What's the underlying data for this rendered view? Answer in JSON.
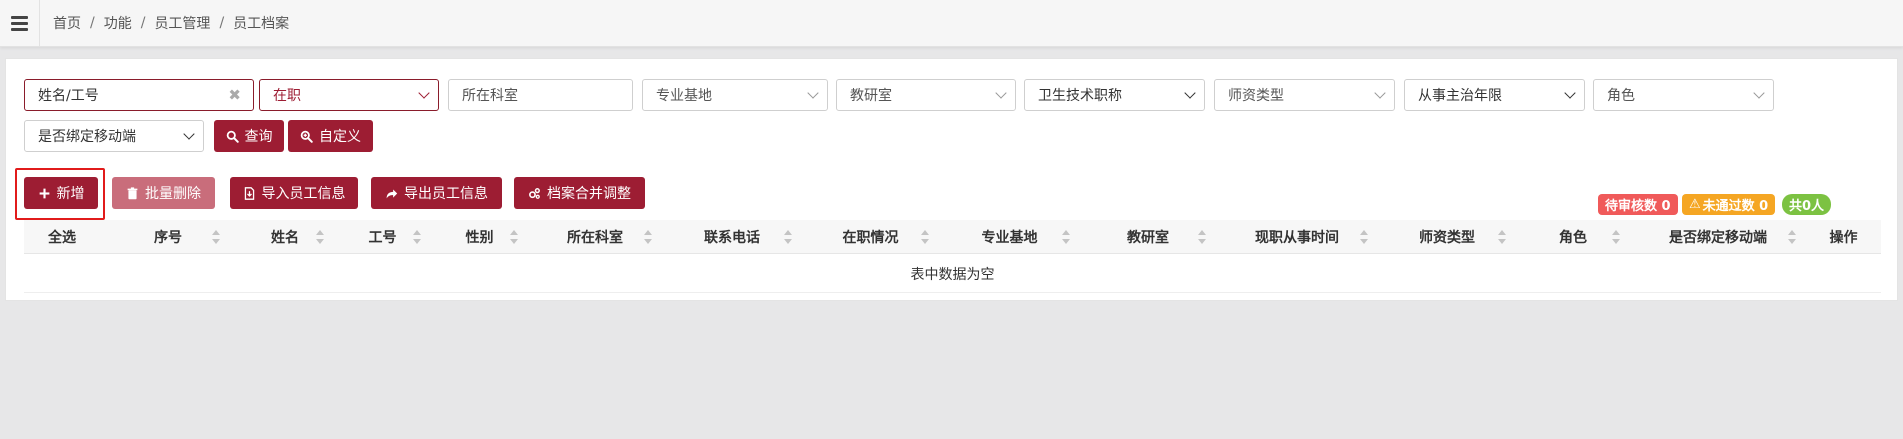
{
  "breadcrumb": [
    "首页",
    "功能",
    "员工管理",
    "员工档案"
  ],
  "filters": {
    "name_or_id": "姓名/工号",
    "employment_status": "在职",
    "department_placeholder": "所在科室",
    "specialty_base": "专业基地",
    "teaching_office": "教研室",
    "health_tech_title": "卫生技术职称",
    "teacher_type": "师资类型",
    "attending_years": "从事主治年限",
    "role": "角色",
    "mobile_bound": "是否绑定移动端"
  },
  "buttons": {
    "query": "查询",
    "custom": "自定义",
    "add": "新增",
    "batch_delete": "批量删除",
    "import": "导入员工信息",
    "export": "导出员工信息",
    "merge": "档案合并调整"
  },
  "badges": {
    "pending": "待审核数 0",
    "rejected": "未通过数 0",
    "total": "共0人"
  },
  "table": {
    "columns": [
      "全选",
      "序号",
      "姓名",
      "工号",
      "性别",
      "所在科室",
      "联系电话",
      "在职情况",
      "专业基地",
      "教研室",
      "现职从事时间",
      "师资类型",
      "角色",
      "是否绑定移动端",
      "操作"
    ],
    "empty_text": "表中数据为空"
  },
  "colors": {
    "primary": "#9d1d33",
    "disabled": "#c96d7b",
    "pending_badge": "#f05a5a",
    "rejected_badge": "#f5a623",
    "total_badge": "#7cc242",
    "highlight": "#e11b1b"
  }
}
